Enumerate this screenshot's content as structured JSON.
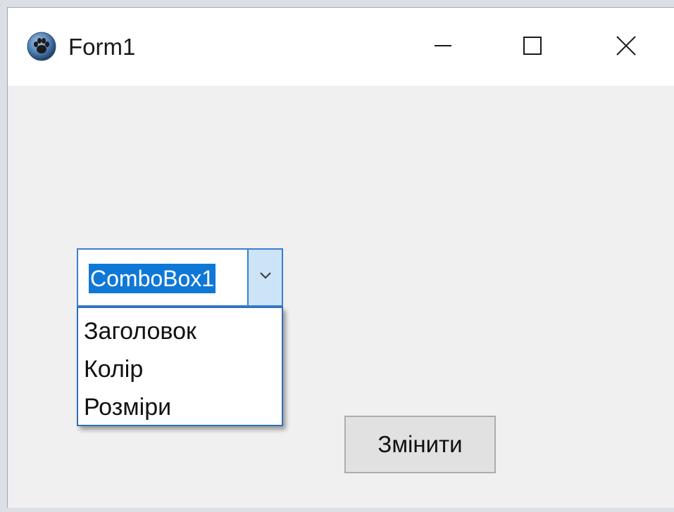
{
  "window": {
    "title": "Form1",
    "icon": "paw-icon",
    "controls": {
      "minimize_icon": "minimize-icon",
      "maximize_icon": "maximize-icon",
      "close_icon": "close-icon"
    }
  },
  "combobox": {
    "value": "ComboBox1",
    "options": [
      "Заголовок",
      "Колір",
      "Розміри"
    ]
  },
  "button": {
    "label": "Змінити"
  },
  "colors": {
    "selection": "#0f78d7",
    "focus_border": "#3a7fcf",
    "arrow_bg": "#cce4f7",
    "form_bg": "#f0f0f0"
  }
}
